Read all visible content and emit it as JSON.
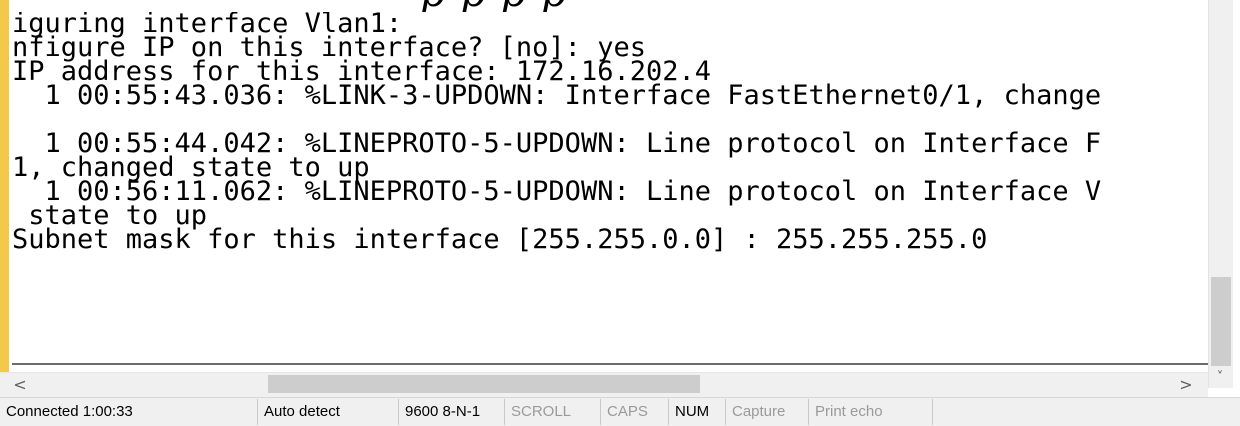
{
  "terminal": {
    "lines": [
      "iguring interface Vlan1:",
      "nfigure IP on this interface? [no]: yes",
      "IP address for this interface: 172.16.202.4",
      "  1 00:55:43.036: %LINK-3-UPDOWN: Interface FastEthernet0/1, change",
      "",
      "  1 00:55:44.042: %LINEPROTO-5-UPDOWN: Line protocol on Interface F",
      "1, changed state to up",
      "  1 00:56:11.062: %LINEPROTO-5-UPDOWN: Line protocol on Interface V",
      " state to up",
      "Subnet mask for this interface [255.255.0.0] : 255.255.255.0"
    ]
  },
  "scrollbars": {
    "vertical_down_arrow": "˅",
    "left_arrow": "<",
    "right_arrow": ">"
  },
  "status_bar": {
    "connected": "Connected 1:00:33",
    "detect": "Auto detect",
    "port_settings": "9600 8-N-1",
    "scroll": "SCROLL",
    "caps": "CAPS",
    "num": "NUM",
    "capture": "Capture",
    "print_echo": "Print echo"
  }
}
